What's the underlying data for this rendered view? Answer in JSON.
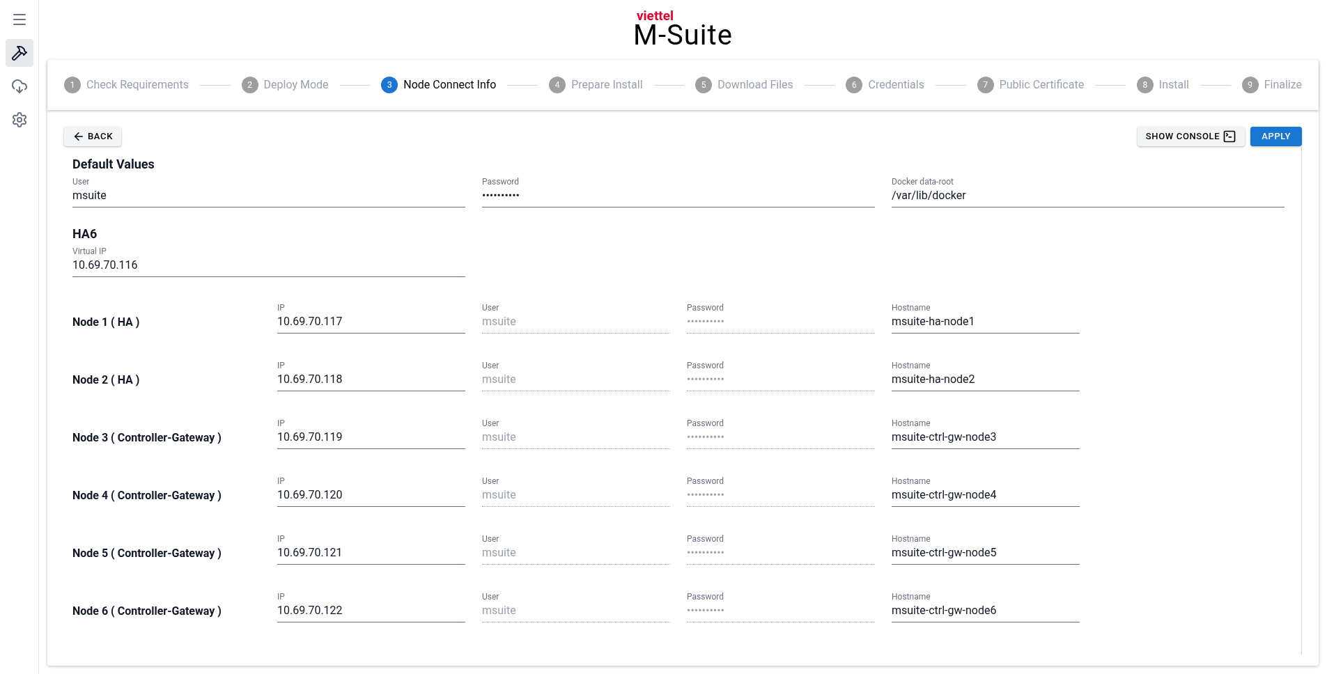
{
  "logo": {
    "brand": "viettel",
    "product": "M-Suite"
  },
  "sidebar": {
    "items": [
      {
        "kind": "menu",
        "selected": false
      },
      {
        "kind": "tools",
        "selected": true
      },
      {
        "kind": "cloud",
        "selected": false
      },
      {
        "kind": "settings",
        "selected": false
      }
    ]
  },
  "stepper": [
    {
      "number": "1",
      "label": "Check Requirements",
      "selected": false
    },
    {
      "number": "2",
      "label": "Deploy Mode",
      "selected": false
    },
    {
      "number": "3",
      "label": "Node Connect Info",
      "selected": true
    },
    {
      "number": "4",
      "label": "Prepare Install",
      "selected": false
    },
    {
      "number": "5",
      "label": "Download Files",
      "selected": false
    },
    {
      "number": "6",
      "label": "Credentials",
      "selected": false
    },
    {
      "number": "7",
      "label": "Public Certificate",
      "selected": false
    },
    {
      "number": "8",
      "label": "Install",
      "selected": false
    },
    {
      "number": "9",
      "label": "Finalize",
      "selected": false
    }
  ],
  "back_button": "BACK",
  "console_button": "SHOW CONSOLE",
  "apply_button": "APPLY",
  "default_values": {
    "title": "Default Values",
    "fields": [
      {
        "label": "User",
        "value": "msuite"
      },
      {
        "label": "Password",
        "value": "••••••••••"
      },
      {
        "label": "Docker data-root",
        "value": "/var/lib/docker"
      }
    ]
  },
  "cluster": {
    "title": "HA6",
    "virtual_ip": {
      "label": "Virtual IP",
      "value": "10.69.70.116"
    }
  },
  "nodes": [
    {
      "name": "Node 1 ( HA )",
      "fields": [
        {
          "label": "IP",
          "value": "10.69.70.117",
          "disabled": false
        },
        {
          "label": "User",
          "value": "msuite",
          "disabled": true
        },
        {
          "label": "Password",
          "value": "••••••••••",
          "disabled": true
        },
        {
          "label": "Hostname",
          "value": "msuite-ha-node1",
          "disabled": false
        }
      ]
    },
    {
      "name": "Node 2 ( HA )",
      "fields": [
        {
          "label": "IP",
          "value": "10.69.70.118",
          "disabled": false
        },
        {
          "label": "User",
          "value": "msuite",
          "disabled": true
        },
        {
          "label": "Password",
          "value": "••••••••••",
          "disabled": true
        },
        {
          "label": "Hostname",
          "value": "msuite-ha-node2",
          "disabled": false
        }
      ]
    },
    {
      "name": "Node 3 ( Controller-Gateway )",
      "fields": [
        {
          "label": "IP",
          "value": "10.69.70.119",
          "disabled": false
        },
        {
          "label": "User",
          "value": "msuite",
          "disabled": true
        },
        {
          "label": "Password",
          "value": "••••••••••",
          "disabled": true
        },
        {
          "label": "Hostname",
          "value": "msuite-ctrl-gw-node3",
          "disabled": false
        }
      ]
    },
    {
      "name": "Node 4 ( Controller-Gateway )",
      "fields": [
        {
          "label": "IP",
          "value": "10.69.70.120",
          "disabled": false
        },
        {
          "label": "User",
          "value": "msuite",
          "disabled": true
        },
        {
          "label": "Password",
          "value": "••••••••••",
          "disabled": true
        },
        {
          "label": "Hostname",
          "value": "msuite-ctrl-gw-node4",
          "disabled": false
        }
      ]
    },
    {
      "name": "Node 5 ( Controller-Gateway )",
      "fields": [
        {
          "label": "IP",
          "value": "10.69.70.121",
          "disabled": false
        },
        {
          "label": "User",
          "value": "msuite",
          "disabled": true
        },
        {
          "label": "Password",
          "value": "••••••••••",
          "disabled": true
        },
        {
          "label": "Hostname",
          "value": "msuite-ctrl-gw-node5",
          "disabled": false
        }
      ]
    },
    {
      "name": "Node 6 ( Controller-Gateway )",
      "fields": [
        {
          "label": "IP",
          "value": "10.69.70.122",
          "disabled": false
        },
        {
          "label": "User",
          "value": "msuite",
          "disabled": true
        },
        {
          "label": "Password",
          "value": "••••••••••",
          "disabled": true
        },
        {
          "label": "Hostname",
          "value": "msuite-ctrl-gw-node6",
          "disabled": false
        }
      ]
    }
  ]
}
